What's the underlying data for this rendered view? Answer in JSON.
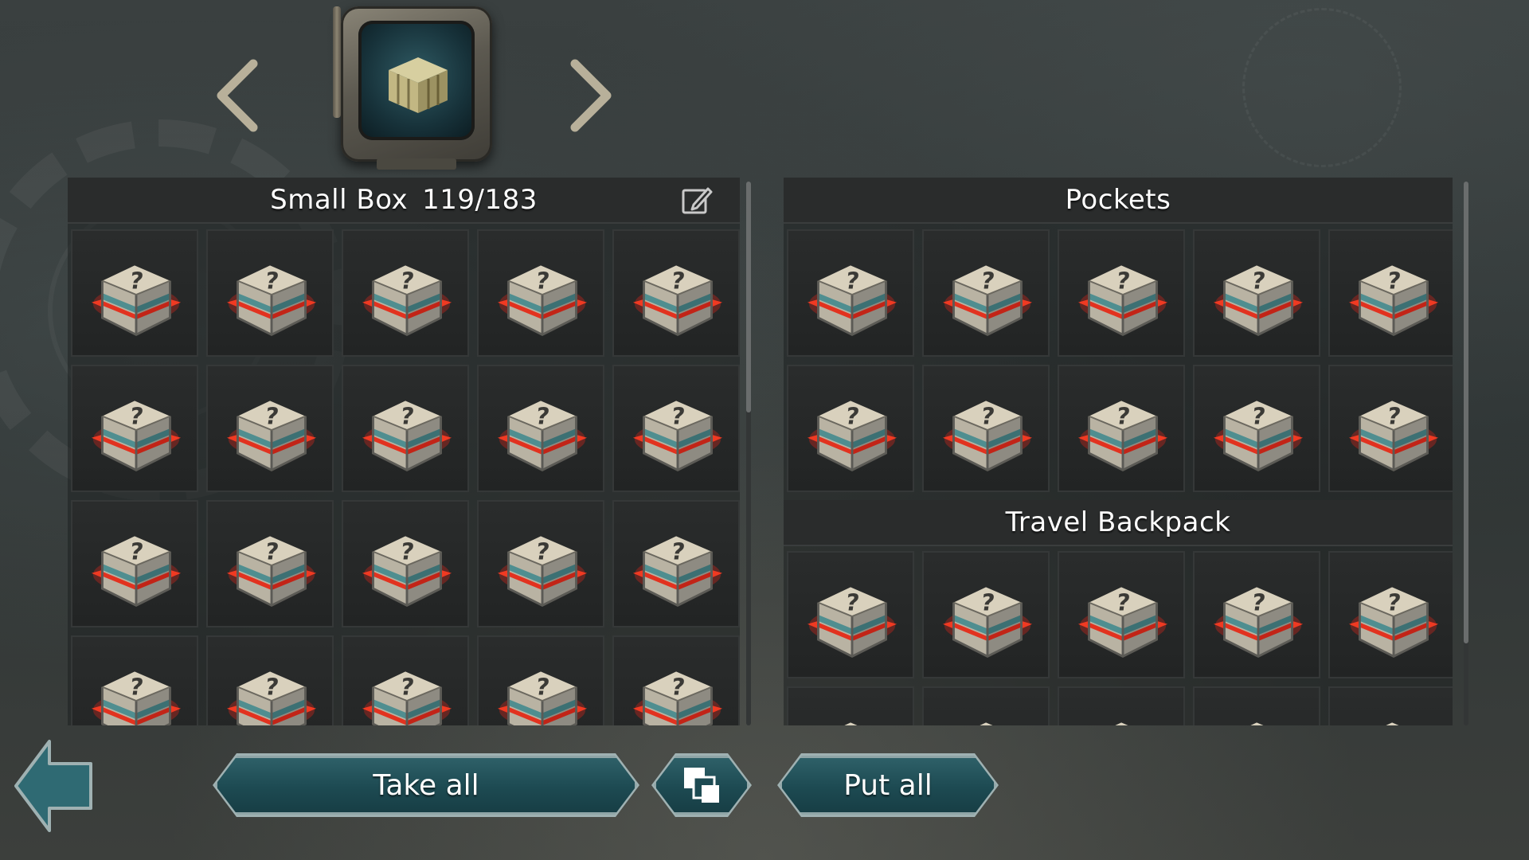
{
  "container": {
    "name": "Small Box",
    "capacity": "119/183",
    "icon": "crate-icon",
    "prev_icon": "chevron-left-icon",
    "next_icon": "chevron-right-icon",
    "edit_icon": "pencil-edit-icon",
    "rows_visible": 4,
    "columns": 5
  },
  "inventory": {
    "sections": [
      {
        "title": "Pockets",
        "rows_visible": 2,
        "columns": 5
      },
      {
        "title": "Travel Backpack",
        "rows_visible": 2,
        "columns": 5
      }
    ]
  },
  "item": {
    "name": "mystery-loot-box",
    "icon": "question-crate-icon"
  },
  "actions": {
    "take_all": "Take all",
    "put_all": "Put all",
    "stack_icon": "stack-icon",
    "back_icon": "back-arrow-icon"
  },
  "colors": {
    "button_fill": "#1d4a52",
    "button_border": "#9fb1b2",
    "slot_bg": "#262828",
    "accent_red": "#d92a1c"
  }
}
